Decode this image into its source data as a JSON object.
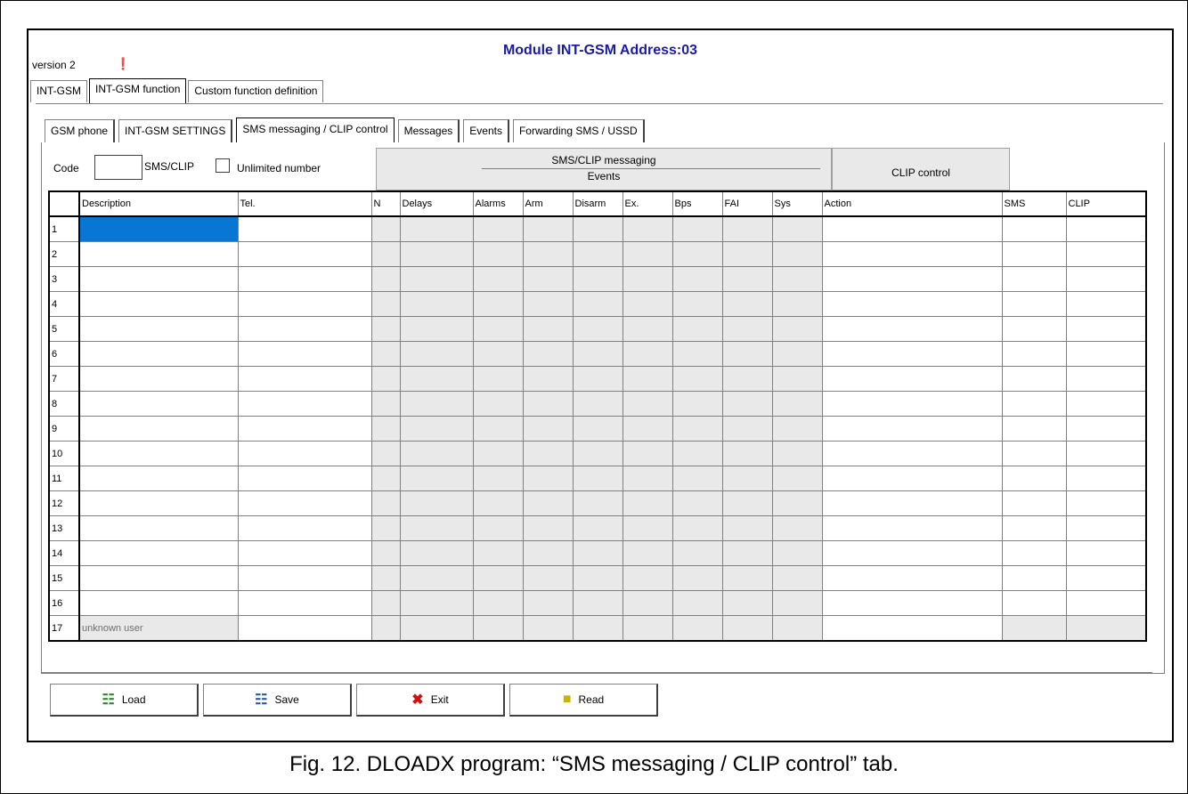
{
  "window": {
    "title": "Module INT-GSM Address:03",
    "version_label": "version 2",
    "version_icon": "module-icon"
  },
  "top_tabs": [
    {
      "label": "INT-GSM",
      "active": false
    },
    {
      "label": "INT-GSM function",
      "active": true
    },
    {
      "label": "Custom function definition",
      "active": false
    }
  ],
  "sub_tabs": [
    {
      "label": "GSM phone",
      "active": false
    },
    {
      "label": "INT-GSM SETTINGS",
      "active": false
    },
    {
      "label": "SMS messaging / CLIP control",
      "active": true
    },
    {
      "label": "Messages",
      "active": false
    },
    {
      "label": "Events",
      "active": false
    },
    {
      "label": "Forwarding SMS / USSD",
      "active": false
    }
  ],
  "controls": {
    "code_label": "Code",
    "code_value": "",
    "sms_label": "SMS/CLIP",
    "checkbox_label": "Unlimited number"
  },
  "groups": {
    "sms_clip": "SMS/CLIP messaging",
    "sms_clip_sub": "Events",
    "clip_control": "CLIP control"
  },
  "grid": {
    "headers": [
      "",
      "Description",
      "Tel.",
      "N",
      "Delays",
      "Alarms",
      "Arm",
      "Disarm",
      "Ex.",
      "Bps",
      "FAI",
      "Sys",
      "Action",
      "SMS",
      "CLIP"
    ],
    "rows": [
      "1",
      "2",
      "3",
      "4",
      "5",
      "6",
      "7",
      "8",
      "9",
      "10",
      "11",
      "12",
      "13",
      "14",
      "15",
      "16"
    ],
    "last_row": {
      "num": "17",
      "desc": "unknown user"
    }
  },
  "buttons": [
    {
      "label": "Load",
      "icon": "load-icon"
    },
    {
      "label": "Save",
      "icon": "save-icon"
    },
    {
      "label": "Exit",
      "icon": "exit-icon"
    },
    {
      "label": "Read",
      "icon": "read-icon"
    }
  ],
  "caption": "Fig. 12. DLOADX program: “SMS messaging / CLIP control” tab."
}
